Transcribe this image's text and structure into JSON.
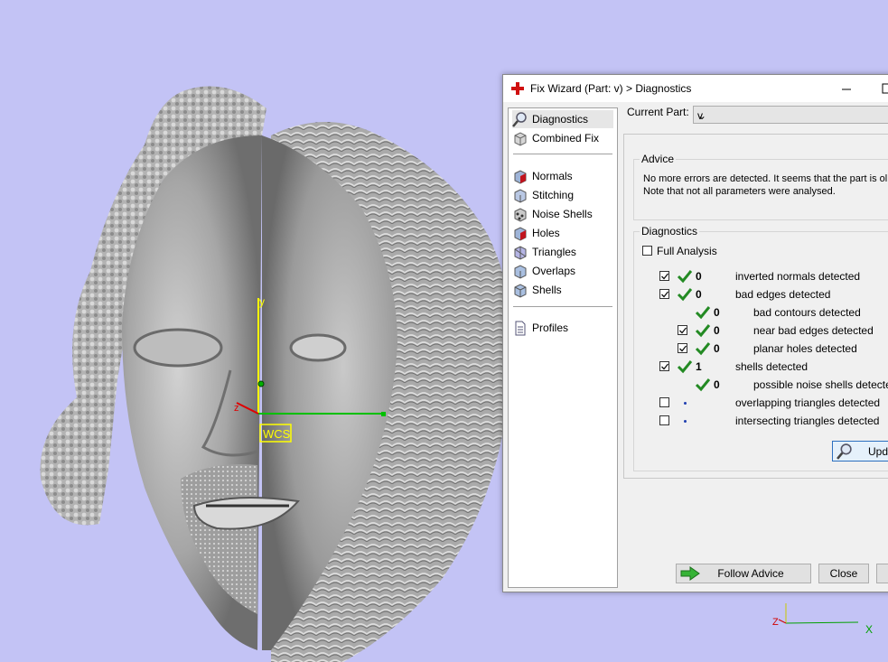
{
  "colors": {
    "background": "#c3c3f5",
    "model": "#9d9d9d",
    "check": "#238a23",
    "axis_y": "#ffff00",
    "axis_x": "#00c000",
    "axis_z": "#e00000"
  },
  "viewport": {
    "wcs_label": "WCS",
    "axis_y_label": "y",
    "axis_z_label": "z",
    "axis_x_label": "x",
    "corner_axis_z_label": "Z",
    "corner_axis_x_label": "X"
  },
  "dialog": {
    "title": "Fix Wizard (Part: v) > Diagnostics",
    "title_icon": "red-cross-icon",
    "nav": {
      "items": [
        {
          "label": "Diagnostics",
          "icon": "magnifier-icon"
        },
        {
          "label": "Combined Fix",
          "icon": "cube-icon"
        },
        {
          "label": "Normals",
          "icon": "normals-cube-icon"
        },
        {
          "label": "Stitching",
          "icon": "stitching-cube-icon"
        },
        {
          "label": "Noise Shells",
          "icon": "noise-shells-icon"
        },
        {
          "label": "Holes",
          "icon": "holes-cube-icon"
        },
        {
          "label": "Triangles",
          "icon": "triangles-cube-icon"
        },
        {
          "label": "Overlaps",
          "icon": "overlaps-cube-icon"
        },
        {
          "label": "Shells",
          "icon": "shells-cube-icon"
        },
        {
          "label": "Profiles",
          "icon": "document-icon"
        }
      ]
    },
    "current_part_label": "Current Part:",
    "current_part_value": "v",
    "advice": {
      "title": "Advice",
      "line1": "No more errors are detected. It seems that the part is ol",
      "line2": "Note that not all parameters were analysed."
    },
    "diagnostics": {
      "title": "Diagnostics",
      "full_analysis_label": "Full Analysis",
      "rows": [
        {
          "count": "0",
          "label": "inverted normals detected"
        },
        {
          "count": "0",
          "label": "bad edges detected"
        },
        {
          "count": "0",
          "label": "bad contours detected"
        },
        {
          "count": "0",
          "label": "near bad edges detected"
        },
        {
          "count": "0",
          "label": "planar holes detected"
        },
        {
          "count": "1",
          "label": "shells detected"
        },
        {
          "count": "0",
          "label": "possible noise shells detected"
        },
        {
          "count": "",
          "label": "overlapping triangles detected"
        },
        {
          "count": "",
          "label": "intersecting triangles detected"
        }
      ],
      "update_button_label": "Upda"
    },
    "follow_advice_label": "Follow Advice",
    "close_label": "Close"
  }
}
